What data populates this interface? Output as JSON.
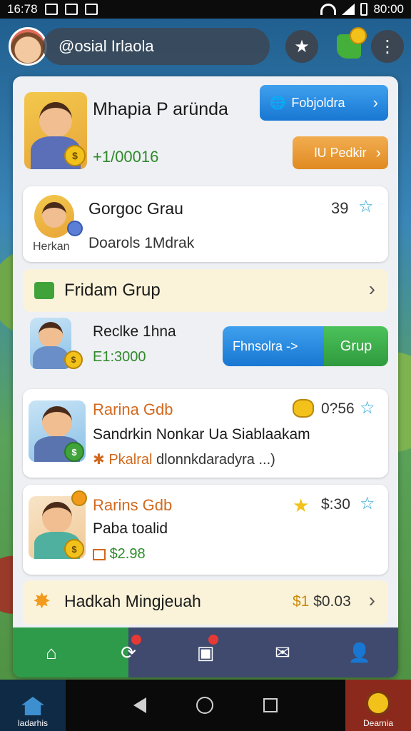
{
  "status_bar": {
    "time": "16:78",
    "clock": "80:00"
  },
  "header": {
    "username": "@osial Irlaola"
  },
  "profile_card": {
    "name": "Mhapia P aründa",
    "coins": "+1/00016",
    "button_primary": "Fobjoldra",
    "button_secondary": "lU Pedkir"
  },
  "friend_card": {
    "name": "Gorgoc Grau",
    "sub": "Doarols 1Mdrak",
    "avatar_caption": "Herkan",
    "count": "39"
  },
  "group_section": {
    "title": "Fridam Grup",
    "member_name": "Reclke 1hna",
    "member_coins": "E1:3000",
    "button_blue": "Fhnsolra ->",
    "button_green": "Grup"
  },
  "post_1": {
    "name": "Rarina Gdb",
    "amount": "0?56",
    "line1": "Sandrkin Nonkar Ua Siablaakam",
    "tag": "Pkalral",
    "line2": "dlonnkdaradyra ...)"
  },
  "post_2": {
    "name": "Rarins Gdb",
    "amount": "$:30",
    "line1": "Paba toalid",
    "coins": "$2.98"
  },
  "footer_section": {
    "title": "Hadkah Mingjeuah",
    "amount_prefix": "$1",
    "amount": "$0.03"
  },
  "sys_nav": {
    "left_label": "ladarhis",
    "right_label": "Dearnia"
  },
  "colors": {
    "accent_blue": "#1877d2",
    "accent_green": "#2e9b4a",
    "accent_orange": "#e08a22"
  }
}
